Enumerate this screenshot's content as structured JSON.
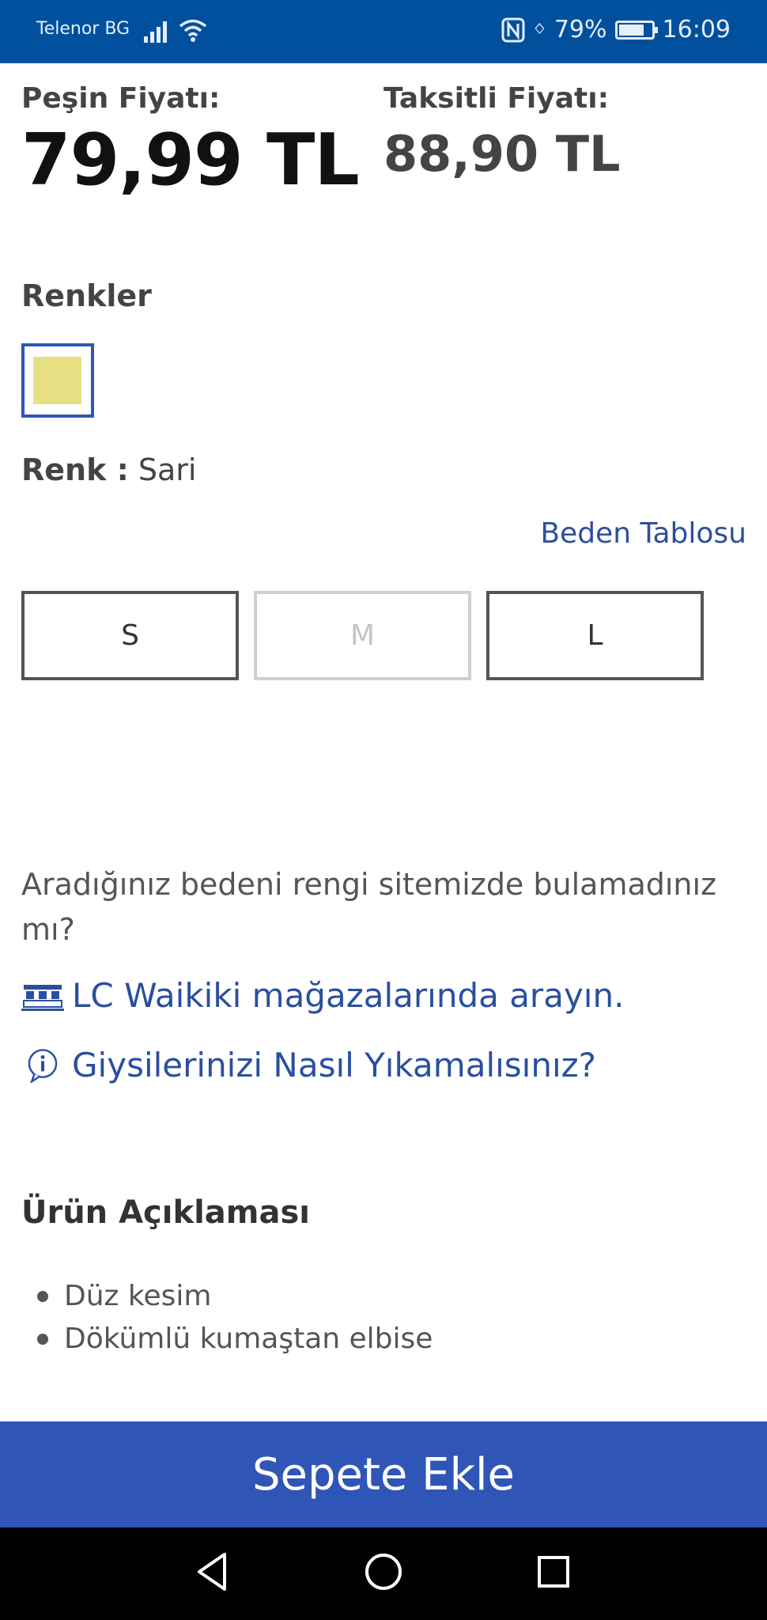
{
  "status_bar": {
    "carrier": "Telenor BG",
    "battery": "79%",
    "battery_level": 0.79,
    "time": "16:09"
  },
  "prices": {
    "cash_label": "Peşin Fiyatı:",
    "cash_value": "79,99 TL",
    "installment_label": "Taksitli Fiyatı:",
    "installment_value": "88,90 TL"
  },
  "colors": {
    "title": "Renkler",
    "swatch_color": "#e6e083",
    "selected_label": "Renk :",
    "selected_value": "Sari"
  },
  "sizes": {
    "size_table_link": "Beden Tablosu",
    "options": [
      {
        "label": "S",
        "available": true
      },
      {
        "label": "M",
        "available": false
      },
      {
        "label": "L",
        "available": true
      }
    ]
  },
  "store_search": {
    "question": "Aradığınız bedeni rengi sitemizde bulamadınız mı?",
    "store_link": "LC Waikiki mağazalarında arayın.",
    "wash_link": "Giysilerinizi Nasıl Yıkamalısınız?"
  },
  "description": {
    "title": "Ürün Açıklaması",
    "items": [
      "Düz kesim",
      "Dökümlü kumaştan elbise"
    ]
  },
  "cart": {
    "button_label": "Sepete Ekle",
    "accent": "#2f55b6"
  }
}
